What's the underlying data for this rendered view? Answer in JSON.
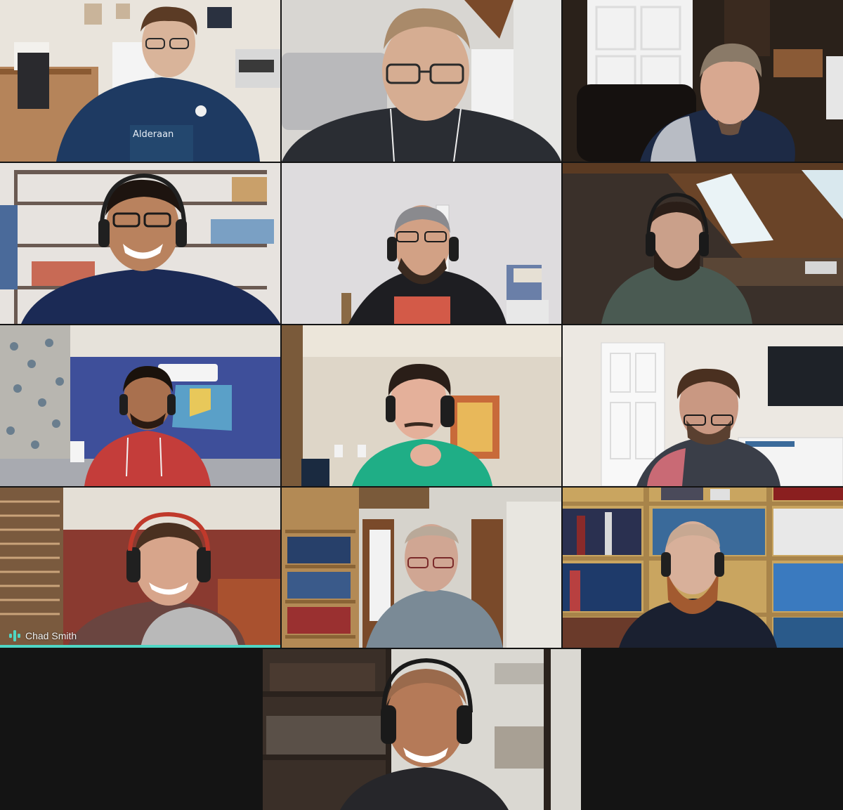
{
  "meeting": {
    "active_speaker_color": "#4fd6c4",
    "background": "#141414"
  },
  "participants": [
    {
      "id": "p1",
      "name": "",
      "shirt_text": "Alderaan",
      "shirt_color": "#1e3a62",
      "wall": "#e9e4dc",
      "skin": "#d9b49a",
      "hair": "#5b3b25",
      "headset": false,
      "glasses": true
    },
    {
      "id": "p2",
      "name": "",
      "shirt_color": "#2a2d33",
      "wall": "#d8d6d2",
      "skin": "#d6ad92",
      "hair": "#6a5030",
      "headset": false,
      "glasses": true
    },
    {
      "id": "p3",
      "name": "",
      "shirt_color": "#1d2a45",
      "wall": "#2a211a",
      "skin": "#d8a890",
      "hair": "#8a7a68",
      "headset": false,
      "glasses": false
    },
    {
      "id": "p4",
      "name": "",
      "shirt_color": "#1b2a55",
      "wall": "#e7e3df",
      "skin": "#b9825e",
      "hair": "#1d140f",
      "headset": true,
      "glasses": true
    },
    {
      "id": "p5",
      "name": "",
      "shirt_color": "#d35a48",
      "wall": "#dedcde",
      "skin": "#d2a185",
      "hair": "#3a2a20",
      "headset": true,
      "glasses": true
    },
    {
      "id": "p6",
      "name": "",
      "shirt_color": "#4a5a52",
      "wall": "#3a302a",
      "skin": "#caa08a",
      "hair": "#2a1e18",
      "headset": true,
      "glasses": false
    },
    {
      "id": "p7",
      "name": "",
      "shirt_color": "#c43d3a",
      "wall": "#3e4f9a",
      "skin": "#a9704e",
      "hair": "#1a120c",
      "headset": true,
      "glasses": false
    },
    {
      "id": "p8",
      "name": "",
      "shirt_color": "#1fae86",
      "wall": "#ded6c8",
      "skin": "#e4b09a",
      "hair": "#2a1e18",
      "headset": true,
      "glasses": false
    },
    {
      "id": "p9",
      "name": "",
      "shirt_color": "#3a3e48",
      "wall": "#ece8e2",
      "skin": "#c99882",
      "hair": "#4a3020",
      "headset": false,
      "glasses": true
    },
    {
      "id": "p10",
      "name": "Chad Smith",
      "shirt_color": "#6a4540",
      "wall": "#8a3a30",
      "skin": "#d7a58b",
      "hair": "#4a3020",
      "headset": true,
      "glasses": false,
      "active_speaker": true
    },
    {
      "id": "p11",
      "name": "",
      "shirt_color": "#7a8a96",
      "wall": "#d6d3cc",
      "skin": "#d0a693",
      "hair": "#b9a999",
      "headset": false,
      "glasses": true
    },
    {
      "id": "p12",
      "name": "",
      "shirt_color": "#1a2030",
      "wall": "#c9a560",
      "skin": "#d8b09a",
      "hair": "#a25a30",
      "headset": true,
      "glasses": false
    },
    {
      "id": "p13",
      "name": "",
      "shirt_color": "#26262a",
      "wall": "#dad8d2",
      "skin": "#b57a58",
      "hair": "#2a1e18",
      "headset": true,
      "glasses": false
    }
  ]
}
